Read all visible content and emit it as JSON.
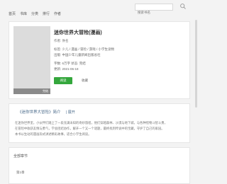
{
  "header": {
    "nav": [
      "首页",
      "书库",
      "分类",
      "排行",
      "作者"
    ],
    "search_placeholder": "搜索书名"
  },
  "book": {
    "cover_badge": "完结",
    "title": "迷你世界大冒险(漫画)",
    "author": "作者: 佚名",
    "meta": [
      "标签: 少儿 / 漫画 / 冒险 / 游戏 / 小学生读物",
      "出版: 中国少年儿童新闻出版总社",
      "字数: 6万字    状态: 完结",
      "更新: 2021-06-18"
    ],
    "read_button": "阅读",
    "favorite_link": "收藏"
  },
  "intro": {
    "title": "《迷你世界大冒险》简介",
    "extra": "| 展开",
    "lines": [
      "在迷你世界里，小伙伴们踏上了一段充满未知的奇妙旅程，他们穿越森林、沙漠与地下城，与各种怪物斗智斗勇，",
      "在冒险中收获友情与勇气，学会团结协作，解开一个又一个谜题，最终找到传说中的宝藏，守护了自己的家园。",
      "本书以生动的漫画形式讲述精彩故事，适合小学生阅读。"
    ]
  },
  "chapters": {
    "title": "全部章节",
    "items": [
      "第1章"
    ]
  }
}
